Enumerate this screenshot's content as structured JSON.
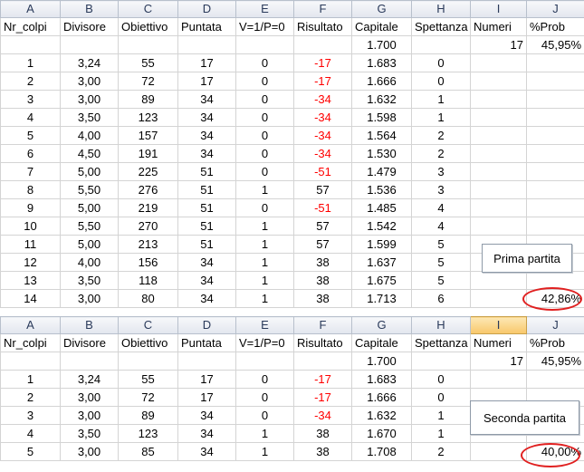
{
  "columns": [
    "A",
    "B",
    "C",
    "D",
    "E",
    "F",
    "G",
    "H",
    "I",
    "J"
  ],
  "headers": [
    "Nr_colpi",
    "Divisore",
    "Obiettivo",
    "Puntata",
    "V=1/P=0",
    "Risultato",
    "Capitale",
    "Spettanza",
    "Numeri",
    "%Prob"
  ],
  "top": {
    "info": {
      "capitale": "1.700",
      "numeri": "17",
      "prob": "45,95%"
    },
    "rows": [
      [
        "1",
        "3,24",
        "55",
        "17",
        "0",
        "-17",
        "1.683",
        "0"
      ],
      [
        "2",
        "3,00",
        "72",
        "17",
        "0",
        "-17",
        "1.666",
        "0"
      ],
      [
        "3",
        "3,00",
        "89",
        "34",
        "0",
        "-34",
        "1.632",
        "1"
      ],
      [
        "4",
        "3,50",
        "123",
        "34",
        "0",
        "-34",
        "1.598",
        "1"
      ],
      [
        "5",
        "4,00",
        "157",
        "34",
        "0",
        "-34",
        "1.564",
        "2"
      ],
      [
        "6",
        "4,50",
        "191",
        "34",
        "0",
        "-34",
        "1.530",
        "2"
      ],
      [
        "7",
        "5,00",
        "225",
        "51",
        "0",
        "-51",
        "1.479",
        "3"
      ],
      [
        "8",
        "5,50",
        "276",
        "51",
        "1",
        "57",
        "1.536",
        "3"
      ],
      [
        "9",
        "5,00",
        "219",
        "51",
        "0",
        "-51",
        "1.485",
        "4"
      ],
      [
        "10",
        "5,50",
        "270",
        "51",
        "1",
        "57",
        "1.542",
        "4"
      ],
      [
        "11",
        "5,00",
        "213",
        "51",
        "1",
        "57",
        "1.599",
        "5"
      ],
      [
        "12",
        "4,00",
        "156",
        "34",
        "1",
        "38",
        "1.637",
        "5"
      ],
      [
        "13",
        "3,50",
        "118",
        "34",
        "1",
        "38",
        "1.675",
        "5"
      ],
      [
        "14",
        "3,00",
        "80",
        "34",
        "1",
        "38",
        "1.713",
        "6"
      ]
    ],
    "final_prob": "42,86%",
    "label": "Prima partita"
  },
  "bottom": {
    "info": {
      "capitale": "1.700",
      "numeri": "17",
      "prob": "45,95%"
    },
    "rows": [
      [
        "1",
        "3,24",
        "55",
        "17",
        "0",
        "-17",
        "1.683",
        "0"
      ],
      [
        "2",
        "3,00",
        "72",
        "17",
        "0",
        "-17",
        "1.666",
        "0"
      ],
      [
        "3",
        "3,00",
        "89",
        "34",
        "0",
        "-34",
        "1.632",
        "1"
      ],
      [
        "4",
        "3,50",
        "123",
        "34",
        "1",
        "38",
        "1.670",
        "1"
      ],
      [
        "5",
        "3,00",
        "85",
        "34",
        "1",
        "38",
        "1.708",
        "2"
      ]
    ],
    "final_prob": "40,00%",
    "label": "Seconda partita"
  },
  "colors": {
    "negative": "#ff0000",
    "circle": "#e02020",
    "selected_header": "#f8c76a"
  }
}
